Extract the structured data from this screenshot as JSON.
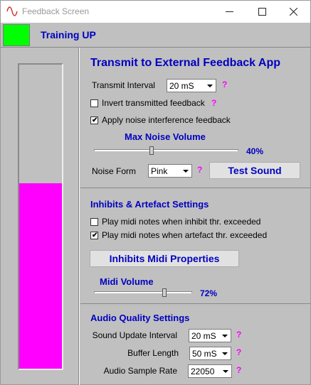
{
  "window": {
    "title": "Feedback Screen",
    "controls": {
      "minimize": "minimize-icon",
      "maximize": "maximize-icon",
      "close": "close-icon"
    }
  },
  "header": {
    "title": "Training UP",
    "status_color": "#00ff00"
  },
  "meter": {
    "level_percent": 61,
    "fill_color": "#ff00ff"
  },
  "transmit": {
    "title": "Transmit to External Feedback App",
    "interval_label": "Transmit Interval",
    "interval_value": "20 mS",
    "invert_label": "Invert transmitted feedback",
    "invert_checked": false,
    "noise_label": "Apply noise interference feedback",
    "noise_checked": true,
    "max_noise_title": "Max Noise Volume",
    "max_noise_percent": 40,
    "max_noise_text": "40%",
    "noise_form_label": "Noise Form",
    "noise_form_value": "Pink",
    "test_sound_label": "Test Sound",
    "help": "?"
  },
  "inhibits": {
    "title": "Inhibits & Artefact Settings",
    "inhibit_label": "Play midi notes when inhibit thr. exceeded",
    "inhibit_checked": false,
    "artefact_label": "Play midi notes when artefact thr. exceeded",
    "artefact_checked": true,
    "midi_props_label": "Inhibits Midi Properties",
    "midi_volume_title": "Midi Volume",
    "midi_volume_percent": 72,
    "midi_volume_text": "72%"
  },
  "audio": {
    "title": "Audio Quality Settings",
    "update_label": "Sound Update Interval",
    "update_value": "20 mS",
    "buffer_label": "Buffer Length",
    "buffer_value": "50 mS",
    "rate_label": "Audio Sample Rate",
    "rate_value": "22050"
  },
  "colors": {
    "accent_text": "#0000c0",
    "help": "#ff00ff",
    "panel": "#c0c0c0"
  }
}
